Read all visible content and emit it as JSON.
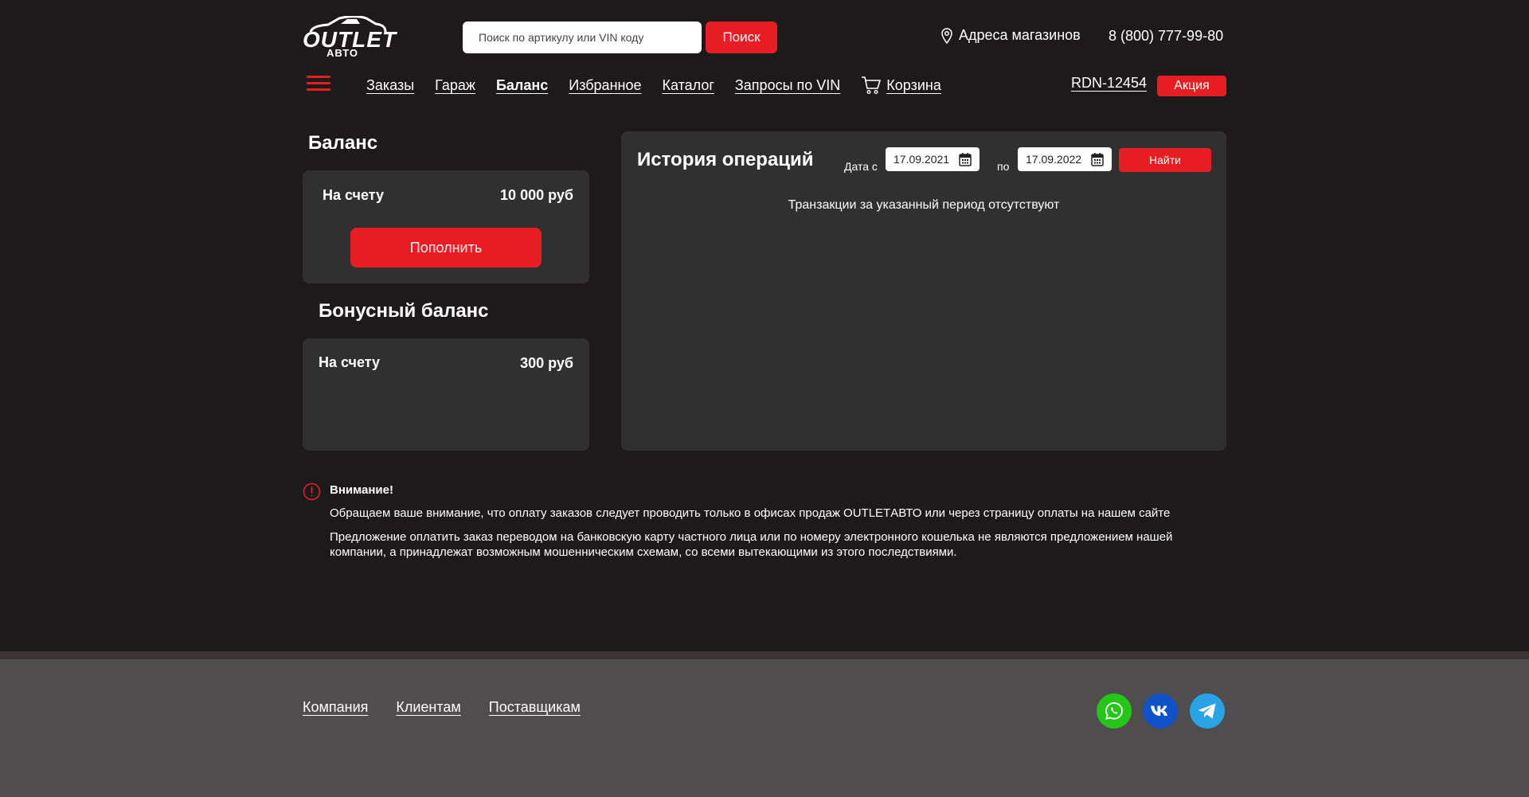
{
  "header": {
    "logo_main": "OUTLET",
    "logo_sub": "АВТО",
    "search_placeholder": "Поиск по артикулу или VIN коду",
    "search_button": "Поиск",
    "stores_label": "Адреса магазинов",
    "phone": "8 (800) 777-99-80"
  },
  "nav": {
    "items": [
      "Заказы",
      "Гараж",
      "Баланс",
      "Избранное",
      "Каталог",
      "Запросы по VIN"
    ],
    "active": "Баланс",
    "cart": "Корзина",
    "account": "RDN-12454",
    "promo": "Акция"
  },
  "balance": {
    "title": "Баланс",
    "label": "На счету",
    "value": "10 000 руб",
    "topup_button": "Пополнить"
  },
  "bonus": {
    "title": "Бонусный баланс",
    "label": "На счету",
    "value": "300 руб"
  },
  "history": {
    "title": "История операций",
    "date_from_label": "Дата с",
    "date_from": "17.09.2021",
    "date_to_label": "по",
    "date_to": "17.09.2022",
    "find_button": "Найти",
    "empty_text": "Транзакции за указанный период отсутствуют"
  },
  "notice": {
    "title": "Внимание!",
    "p1": "Обращаем ваше внимание, что оплату заказов следует проводить только в офисах продаж OUTLETАВТО или через страницу оплаты на нашем сайте",
    "p2": "Предложение оплатить заказ переводом на банковскую карту частного лица или по номеру электронного кошелька не являются предложением нашей компании, а принадлежат возможным мошенническим схемам, со всеми вытекающими из этого последствиями."
  },
  "footer": {
    "links": [
      "Компания",
      "Клиентам",
      "Поставщикам"
    ],
    "social": [
      "whatsapp-icon",
      "vk-icon",
      "telegram-icon"
    ]
  },
  "colors": {
    "background": "#1c1a1b",
    "card": "#313031",
    "accent": "#e61e24",
    "footer": "#4f4d4e",
    "whatsapp": "#25c519",
    "vk": "#0f52c9",
    "telegram": "#2aa3e6"
  }
}
